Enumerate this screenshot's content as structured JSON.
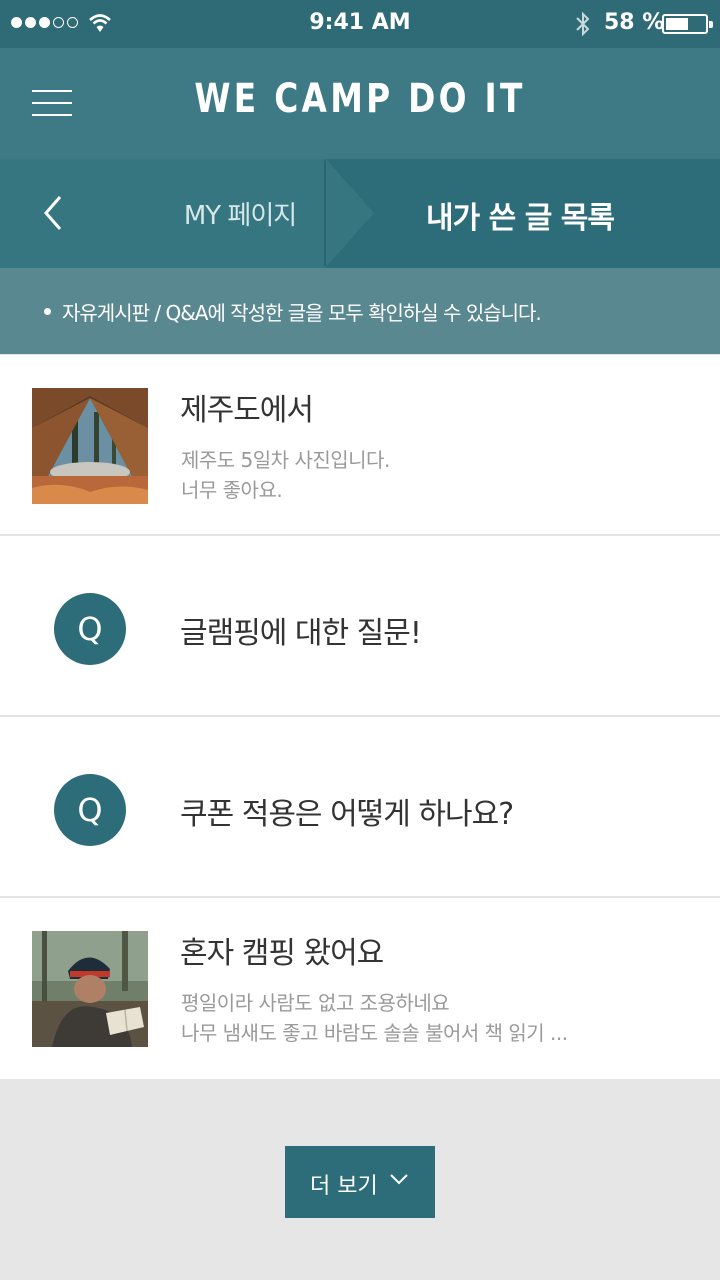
{
  "status_bar": {
    "time": "9:41 AM",
    "battery_percent": "58 %",
    "battery_level": 0.58,
    "signal_dots_filled": 3,
    "signal_dots_total": 5,
    "icons": [
      "signal-dots-icon",
      "wifi-icon",
      "bluetooth-icon",
      "battery-icon"
    ]
  },
  "header": {
    "brand": "WE CAMP DO IT",
    "menu_icon": "hamburger-icon"
  },
  "breadcrumb": {
    "back_icon": "chevron-left-icon",
    "parent": "MY 페이지",
    "current": "내가 쓴 글 목록"
  },
  "notice": {
    "text": "자유게시판 / Q&A에 작성한 글을 모두 확인하실 수 있습니다."
  },
  "posts": [
    {
      "kind": "photo",
      "thumb": "tent-photo",
      "title": "제주도에서",
      "lines": [
        "제주도 5일차 사진입니다.",
        "너무 좋아요."
      ]
    },
    {
      "kind": "question",
      "badge": "Q",
      "title": "글램핑에 대한 질문!"
    },
    {
      "kind": "question",
      "badge": "Q",
      "title": "쿠폰 적용은 어떻게 하나요?"
    },
    {
      "kind": "photo",
      "thumb": "camper-reading-photo",
      "title": "혼자 캠핑 왔어요",
      "lines": [
        "평일이라 사람도 없고 조용하네요",
        "나무 냄새도 좋고 바람도 솔솔 불어서 책 읽기 ..."
      ]
    }
  ],
  "more_button": {
    "label": "더 보기",
    "icon": "chevron-down-icon"
  },
  "colors": {
    "status_bar": "#2e6b77",
    "header": "#3e7a85",
    "breadcrumb": "#2d6d79",
    "notice": "#5a8891",
    "accent": "#2d6d79",
    "page_bg": "#e6e6e6"
  }
}
